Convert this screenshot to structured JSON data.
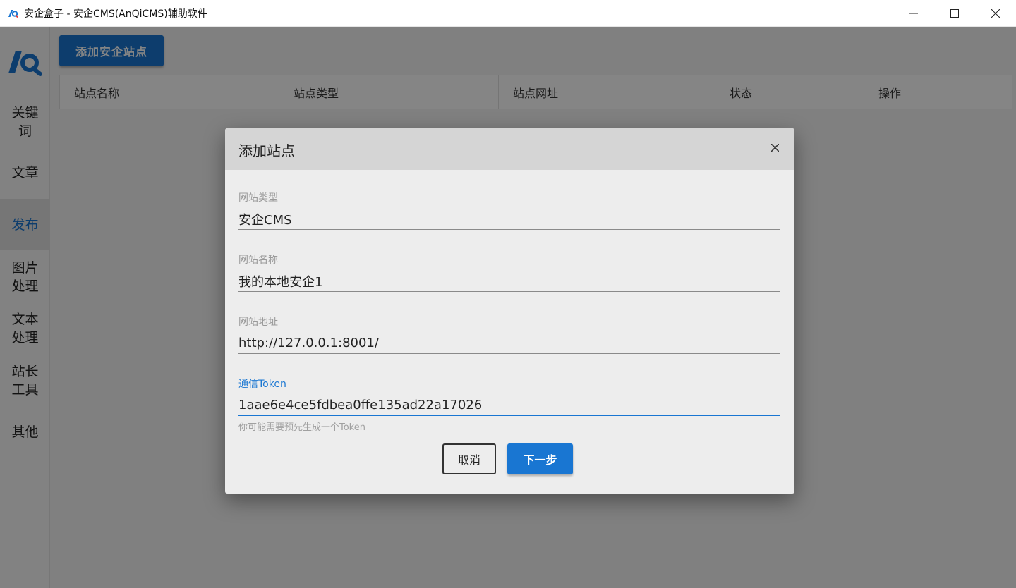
{
  "window": {
    "title": "安企盒子 - 安企CMS(AnQiCMS)辅助软件",
    "minimize": "—",
    "maximize": "☐",
    "close": "✕"
  },
  "sidebar": {
    "items": [
      {
        "label": "关键\n词"
      },
      {
        "label": "文章"
      },
      {
        "label": "发布"
      },
      {
        "label": "图片\n处理"
      },
      {
        "label": "文本\n处理"
      },
      {
        "label": "站长\n工具"
      },
      {
        "label": "其他"
      }
    ],
    "active_index": 2
  },
  "main": {
    "add_button": "添加安企站点",
    "table_headers": [
      "站点名称",
      "站点类型",
      "站点网址",
      "状态",
      "操作"
    ]
  },
  "dialog": {
    "title": "添加站点",
    "close": "×",
    "fields": [
      {
        "label": "网站类型",
        "value": "安企CMS"
      },
      {
        "label": "网站名称",
        "value": "我的本地安企1"
      },
      {
        "label": "网站地址",
        "value": "http://127.0.0.1:8001/"
      },
      {
        "label": "通信Token",
        "value": "1aae6e4ce5fdbea0ffe135ad22a17026",
        "hint": "你可能需要预先生成一个Token"
      }
    ],
    "cancel_label": "取消",
    "next_label": "下一步"
  },
  "colors": {
    "accent": "#1976d2",
    "overlay": "rgba(0,0,0,0.48)"
  }
}
